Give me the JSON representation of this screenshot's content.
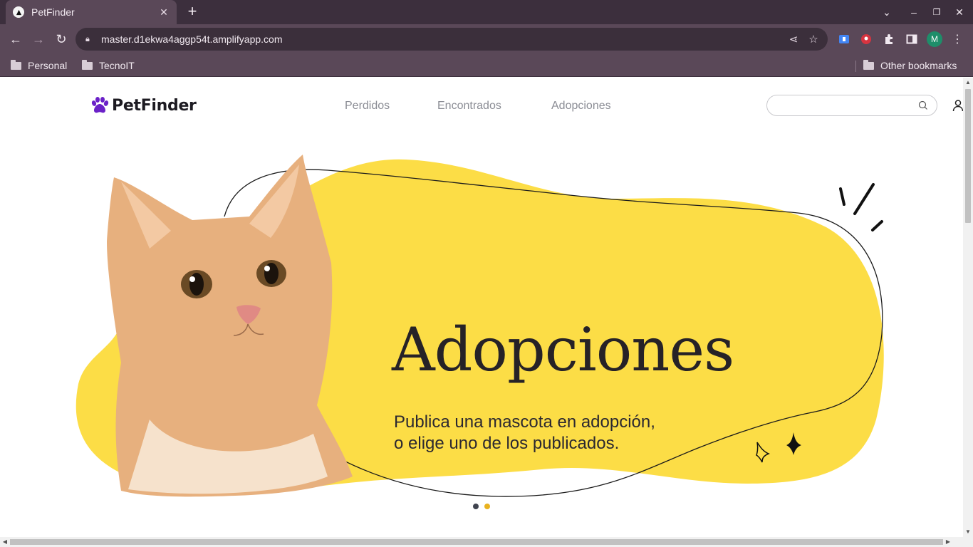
{
  "browser": {
    "tab_title": "PetFinder",
    "url": "master.d1ekwa4aggp54t.amplifyapp.com",
    "profile_initial": "M",
    "bookmarks": [
      {
        "label": "Personal"
      },
      {
        "label": "TecnoIT"
      }
    ],
    "other_bookmarks": "Other bookmarks"
  },
  "site": {
    "brand": "PetFinder",
    "brand_color": "#6b21c8",
    "nav": [
      {
        "label": "Perdidos"
      },
      {
        "label": "Encontrados"
      },
      {
        "label": "Adopciones"
      }
    ],
    "search_placeholder": ""
  },
  "hero": {
    "title": "Adopciones",
    "subtitle_line1": "Publica una mascota en adopción,",
    "subtitle_line2": "o elige uno de los publicados.",
    "blob_color": "#fcdd46",
    "image": "kitten-photo"
  },
  "carousel": {
    "slides": 2,
    "active_index": 1,
    "dot_color": "#40444f",
    "active_dot_color": "#e9b21f"
  }
}
